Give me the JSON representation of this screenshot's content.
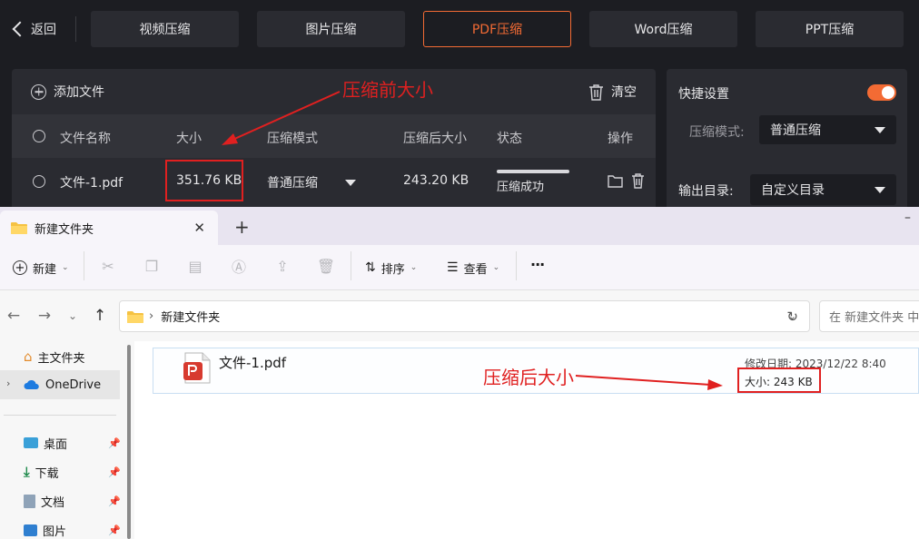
{
  "app": {
    "back_label": "返回",
    "tabs": [
      "视频压缩",
      "图片压缩",
      "PDF压缩",
      "Word压缩",
      "PPT压缩"
    ],
    "add_file_label": "添加文件",
    "clear_label": "清空",
    "columns": [
      "文件名称",
      "大小",
      "压缩模式",
      "压缩后大小",
      "状态",
      "操作"
    ],
    "row": {
      "name": "文件-1.pdf",
      "size": "351.76 KB",
      "mode": "普通压缩",
      "compressed_size": "243.20 KB",
      "status": "压缩成功",
      "progress": 1.0
    },
    "settings": {
      "title": "快捷设置",
      "mode_label": "压缩模式:",
      "mode_value": "普通压缩",
      "output_label": "输出目录:",
      "output_value": "自定义目录"
    },
    "accent_color": "#f36b34"
  },
  "annotations": {
    "before": "压缩前大小",
    "after": "压缩后大小",
    "color": "#e02020"
  },
  "explorer": {
    "tab_title": "新建文件夹",
    "new_label": "新建",
    "sort_label": "排序",
    "view_label": "查看",
    "more_label": "···",
    "address": "新建文件夹",
    "search_placeholder": "在 新建文件夹 中搜",
    "sidebar": {
      "home": "主文件夹",
      "onedrive": "OneDrive",
      "desktop": "桌面",
      "downloads": "下载",
      "documents": "文档",
      "pictures": "图片"
    },
    "file": {
      "name": "文件-1.pdf",
      "modified": "修改日期: 2023/12/22 8:40",
      "size": "大小: 243 KB"
    }
  }
}
